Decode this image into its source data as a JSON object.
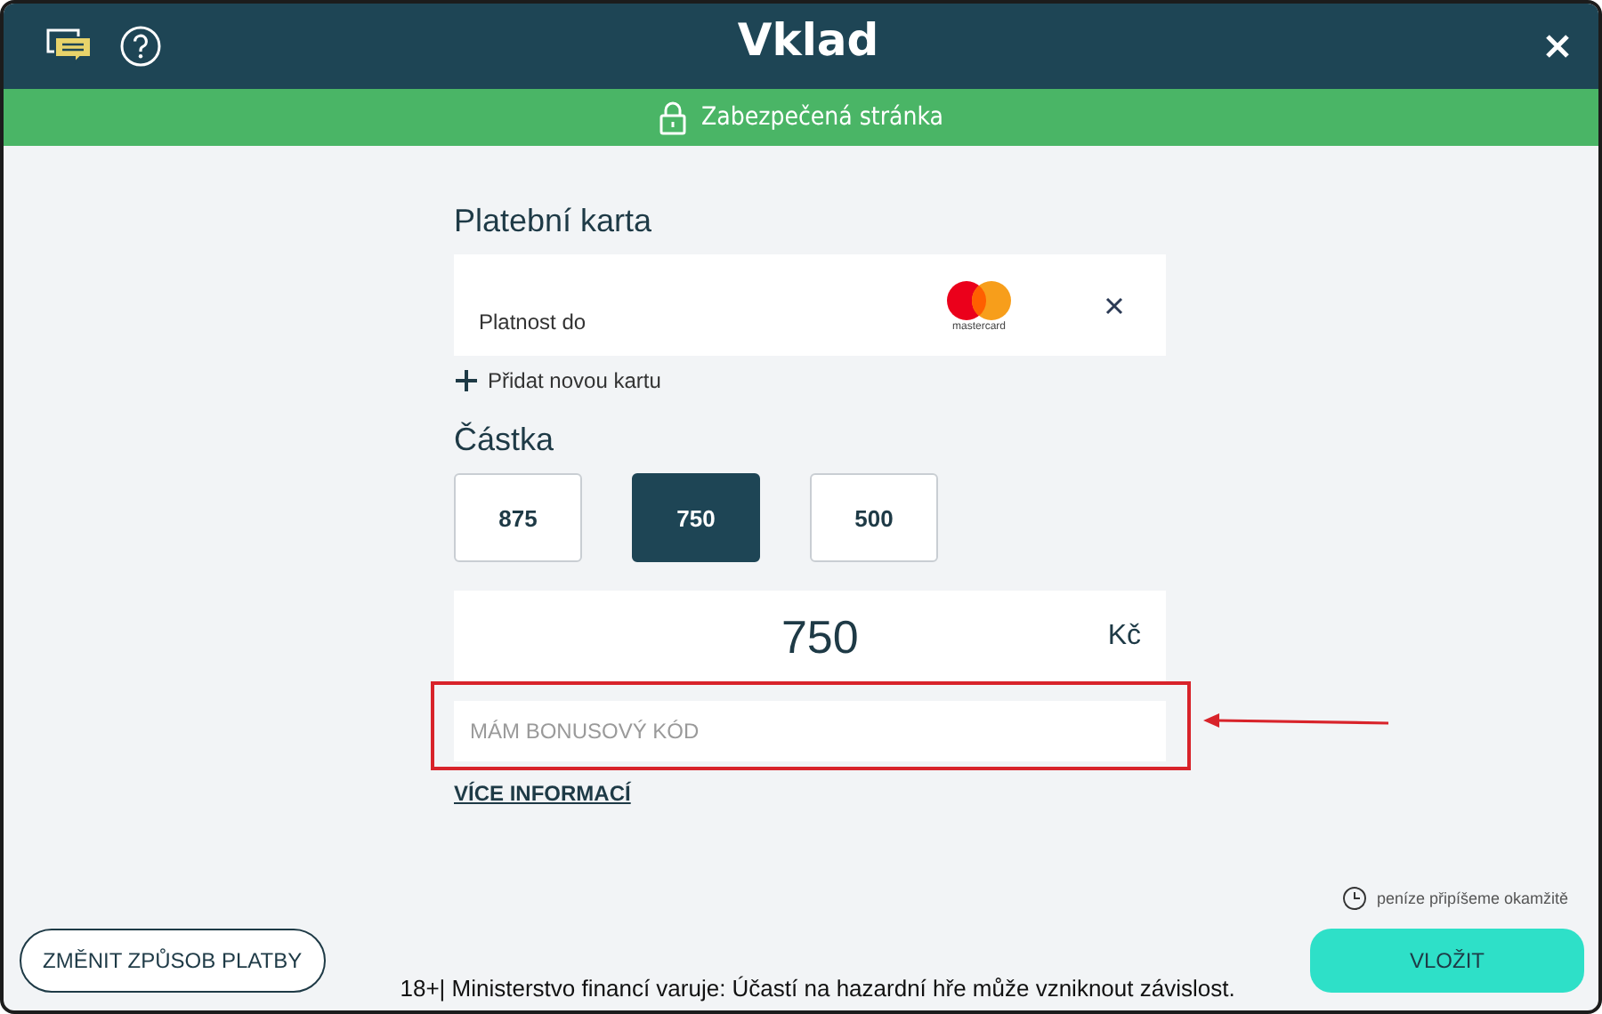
{
  "window": {
    "title": "Vklad"
  },
  "secure_bar": {
    "label": "Zabezpečená stránka"
  },
  "card_section": {
    "title": "Platební karta",
    "card": {
      "expiry_label": "Platnost do",
      "brand": "mastercard"
    },
    "add_card": "Přidat novou kartu"
  },
  "amount_section": {
    "title": "Částka",
    "presets": [
      {
        "label": "875",
        "selected": false
      },
      {
        "label": "750",
        "selected": true
      },
      {
        "label": "500",
        "selected": false
      }
    ],
    "value": "750",
    "currency": "Kč"
  },
  "bonus_code": {
    "placeholder": "MÁM BONUSOVÝ KÓD"
  },
  "more_info": "VÍCE INFORMACÍ",
  "note": "peníze připíšeme okamžitě",
  "buttons": {
    "change_method": "ZMĚNIT ZPŮSOB PLATBY",
    "deposit": "VLOŽIT"
  },
  "disclaimer": "18+| Ministerstvo financí varuje: Účastí na hazardní hře může vzniknout závislost."
}
